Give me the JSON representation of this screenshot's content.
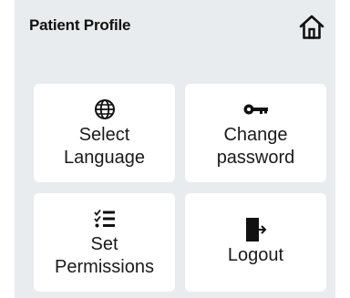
{
  "header": {
    "title": "Patient Profile",
    "home_icon": "home-icon"
  },
  "tiles": [
    {
      "id": "select_language",
      "icon": "globe-icon",
      "label_line1": "Select",
      "label_line2": "Language"
    },
    {
      "id": "change_password",
      "icon": "key-icon",
      "label_line1": "Change",
      "label_line2": "password"
    },
    {
      "id": "set_permissions",
      "icon": "checklist-icon",
      "label_line1": "Set",
      "label_line2": "Permissions"
    },
    {
      "id": "logout",
      "icon": "logout-icon",
      "label_line1": "Logout"
    }
  ],
  "colors": {
    "background": "#e9ecef",
    "tile": "#ffffff",
    "text": "#111111"
  }
}
